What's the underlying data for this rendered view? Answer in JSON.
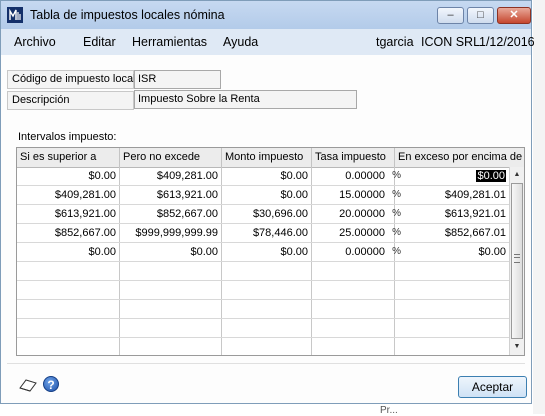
{
  "window": {
    "title": "Tabla de impuestos locales nómina",
    "controls": {
      "minimize": "–",
      "maximize": "□",
      "close": "✕"
    }
  },
  "menu": {
    "items": [
      "Archivo",
      "Editar",
      "Herramientas",
      "Ayuda"
    ],
    "user": "tgarcia",
    "company": "ICON SRL",
    "date": "1/12/2016"
  },
  "form": {
    "tax_code_label": "Código de impuesto local",
    "tax_code_value": "ISR",
    "description_label": "Descripción",
    "description_value": "Impuesto Sobre la Renta"
  },
  "grid": {
    "label": "Intervalos impuesto:",
    "columns": [
      "Si es superior a",
      "Pero no excede",
      "Monto impuesto",
      "Tasa impuesto",
      "En exceso por encima de"
    ],
    "rows": [
      [
        "$0.00",
        "$409,281.00",
        "$0.00",
        "0.00000",
        "$0.00"
      ],
      [
        "$409,281.00",
        "$613,921.00",
        "$0.00",
        "15.00000",
        "$409,281.01"
      ],
      [
        "$613,921.00",
        "$852,667.00",
        "$30,696.00",
        "20.00000",
        "$613,921.01"
      ],
      [
        "$852,667.00",
        "$999,999,999.99",
        "$78,446.00",
        "25.00000",
        "$852,667.01"
      ],
      [
        "$0.00",
        "$0.00",
        "$0.00",
        "0.00000",
        "$0.00"
      ]
    ],
    "empty_rows": 5,
    "percent_symbol": "%",
    "selected_cell": {
      "row": 0,
      "col": 4
    }
  },
  "footer": {
    "accept_button": "Aceptar",
    "help_glyph": "?",
    "note_icon": "note-icon",
    "help_icon": "help-icon"
  },
  "below_window_text": "Pr...",
  "colors": {
    "titlebar": "#b3cbe9",
    "menubar": "#dfe9f5",
    "accent_button": "#cfe2f5",
    "close_button": "#c5462e"
  }
}
